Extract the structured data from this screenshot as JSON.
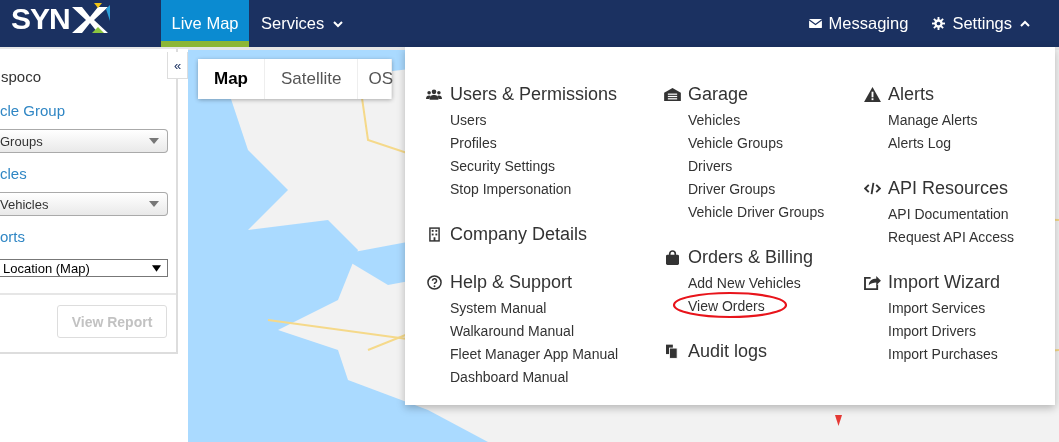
{
  "navbar": {
    "logo": "SYN",
    "tabs": [
      {
        "label": "Live Map",
        "selected": true,
        "kind": "link"
      },
      {
        "label": "Services",
        "selected": false,
        "kind": "dropdown",
        "expanded": false
      }
    ],
    "right": [
      {
        "label": "Messaging",
        "kind": "link"
      },
      {
        "label": "Settings",
        "kind": "dropdown",
        "expanded": true
      }
    ]
  },
  "sidebar": {
    "collapse": "«",
    "fields": [
      {
        "kind": "title",
        "text": "spoco"
      },
      {
        "kind": "label",
        "text": "cle Group"
      },
      {
        "kind": "select",
        "text": "Groups"
      },
      {
        "kind": "label",
        "text": "cles"
      },
      {
        "kind": "select",
        "text": "Vehicles"
      },
      {
        "kind": "label",
        "text": "orts"
      },
      {
        "kind": "native-select",
        "text": "Location (Map)"
      }
    ],
    "button": {
      "label": "View Report",
      "disabled": true
    }
  },
  "map": {
    "kind": "picture",
    "types": [
      {
        "label": "Map",
        "selected": true
      },
      {
        "label": "Satellite",
        "selected": false
      },
      {
        "label": "OS",
        "selected": false
      }
    ]
  },
  "settings_menu": {
    "columns": [
      [
        {
          "title": "Users & Permissions",
          "items": [
            {
              "label": "Users",
              "circled": false
            },
            {
              "label": "Profiles",
              "circled": false
            },
            {
              "label": "Security Settings",
              "circled": false
            },
            {
              "label": "Stop Impersonation",
              "circled": false
            }
          ]
        },
        {
          "title": "Company Details"
        },
        {
          "title": "Help & Support",
          "items": [
            {
              "label": "System Manual",
              "circled": false
            },
            {
              "label": "Walkaround Manual",
              "circled": false
            },
            {
              "label": "Fleet Manager App Manual",
              "circled": false
            },
            {
              "label": "Dashboard Manual",
              "circled": false
            }
          ]
        }
      ],
      [
        {
          "title": "Garage",
          "items": [
            {
              "label": "Vehicles",
              "circled": false
            },
            {
              "label": "Vehicle Groups",
              "circled": false
            },
            {
              "label": "Drivers",
              "circled": false
            },
            {
              "label": "Driver Groups",
              "circled": false
            },
            {
              "label": "Vehicle Driver Groups",
              "circled": false
            }
          ]
        },
        {
          "title": "Orders & Billing",
          "items": [
            {
              "label": "Add New Vehicles",
              "circled": false
            },
            {
              "label": "View Orders",
              "circled": true
            }
          ]
        },
        {
          "title": "Audit logs"
        }
      ],
      [
        {
          "title": "Alerts",
          "items": [
            {
              "label": "Manage Alerts",
              "circled": false
            },
            {
              "label": "Alerts Log",
              "circled": false
            }
          ]
        },
        {
          "title": "API Resources",
          "items": [
            {
              "label": "API Documentation",
              "circled": false
            },
            {
              "label": "Request API Access",
              "circled": false
            }
          ]
        },
        {
          "title": "Import Wizard",
          "items": [
            {
              "label": "Import Services",
              "circled": false
            },
            {
              "label": "Import Drivers",
              "circled": false
            },
            {
              "label": "Import Purchases",
              "circled": false
            }
          ]
        }
      ]
    ]
  }
}
